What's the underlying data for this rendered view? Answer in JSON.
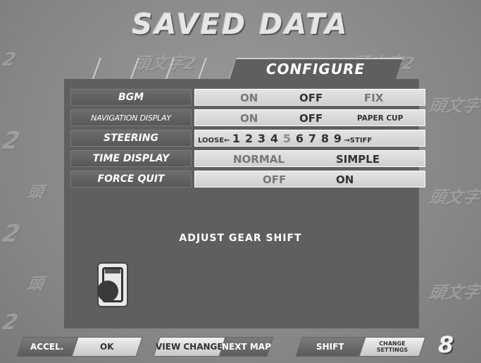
{
  "screen": {
    "title": "SAVED DATA"
  },
  "tab": {
    "active_label": "CONFIGURE"
  },
  "settings": [
    {
      "label": "BGM",
      "options": [
        "ON",
        "OFF",
        "FIX"
      ],
      "selected": "OFF"
    },
    {
      "label": "NAVIGATION DISPLAY",
      "options": [
        "ON",
        "OFF",
        "PAPER CUP"
      ],
      "selected": "OFF"
    },
    {
      "label": "STEERING",
      "left_text": "LOOSE←",
      "levels": [
        "1",
        "2",
        "3",
        "4",
        "5",
        "6",
        "7",
        "8",
        "9"
      ],
      "right_text": "→STIFF",
      "selected_level": "5"
    },
    {
      "label": "TIME DISPLAY",
      "options": [
        "NORMAL",
        "SIMPLE"
      ],
      "selected": "SIMPLE"
    },
    {
      "label": "FORCE QUIT",
      "options": [
        "OFF",
        "ON"
      ],
      "selected": "ON"
    }
  ],
  "prompt": {
    "text": "ADJUST GEAR SHIFT"
  },
  "footer": {
    "accel": "ACCEL.",
    "ok": "OK",
    "view_change": "VIEW CHANGE",
    "next_map": "NEXT MAP",
    "shift": "SHIFT",
    "change_settings": "CHANGE SETTINGS",
    "number": "8"
  },
  "colors": {
    "panel": "#5f5f5f",
    "value_strip": "#dcdcdc",
    "background": "#8e8e8e"
  }
}
